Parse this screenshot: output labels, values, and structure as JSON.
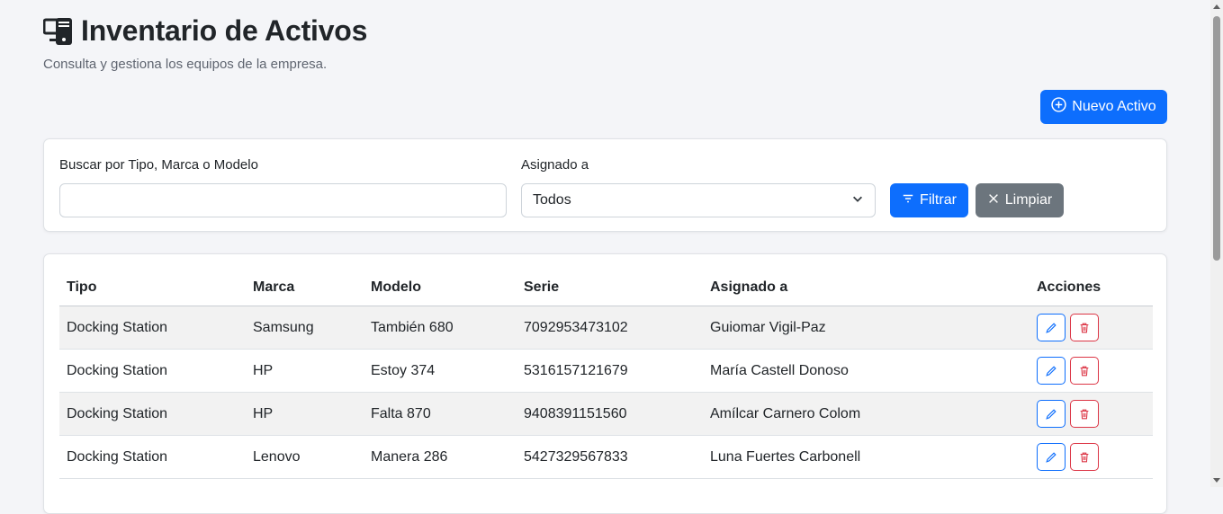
{
  "header": {
    "title": "Inventario de Activos",
    "subtitle": "Consulta y gestiona los equipos de la empresa.",
    "icon": "devices-icon",
    "new_button_label": "Nuevo Activo"
  },
  "filters": {
    "search_label": "Buscar por Tipo, Marca o Modelo",
    "search_value": "",
    "assigned_label": "Asignado a",
    "assigned_selected": "Todos",
    "filter_button_label": "Filtrar",
    "clear_button_label": "Limpiar"
  },
  "table": {
    "columns": [
      "Tipo",
      "Marca",
      "Modelo",
      "Serie",
      "Asignado a",
      "Acciones"
    ],
    "rows": [
      {
        "tipo": "Docking Station",
        "marca": "Samsung",
        "modelo": "También 680",
        "serie": "7092953473102",
        "asignado": "Guiomar Vigil-Paz"
      },
      {
        "tipo": "Docking Station",
        "marca": "HP",
        "modelo": "Estoy 374",
        "serie": "5316157121679",
        "asignado": "María Castell Donoso"
      },
      {
        "tipo": "Docking Station",
        "marca": "HP",
        "modelo": "Falta 870",
        "serie": "9408391151560",
        "asignado": "Amílcar Carnero Colom"
      },
      {
        "tipo": "Docking Station",
        "marca": "Lenovo",
        "modelo": "Manera 286",
        "serie": "5427329567833",
        "asignado": "Luna Fuertes Carbonell"
      }
    ]
  },
  "colors": {
    "primary": "#0d6efd",
    "secondary": "#6c757d",
    "danger": "#dc3545",
    "background": "#f4f5f8"
  }
}
